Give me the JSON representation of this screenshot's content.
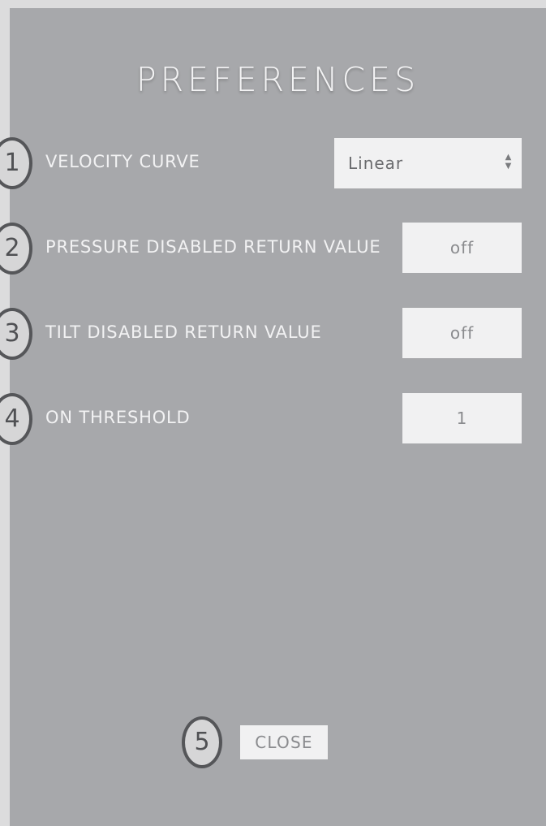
{
  "title": "PREFERENCES",
  "rows": [
    {
      "badge": "1",
      "label": "VELOCITY CURVE",
      "value": "Linear",
      "control": "select"
    },
    {
      "badge": "2",
      "label": "PRESSURE DISABLED RETURN VALUE",
      "value": "off",
      "control": "input"
    },
    {
      "badge": "3",
      "label": "TILT DISABLED RETURN VALUE",
      "value": "off",
      "control": "input"
    },
    {
      "badge": "4",
      "label": "ON THRESHOLD",
      "value": "1",
      "control": "input"
    }
  ],
  "close": {
    "badge": "5",
    "label": "CLOSE"
  },
  "icons": {
    "select_arrows": "up-down-arrows-icon"
  },
  "colors": {
    "background": "#dcdcdd",
    "panel": "#a7a8ab",
    "field": "#f1f1f2",
    "badge_border": "#555659"
  }
}
